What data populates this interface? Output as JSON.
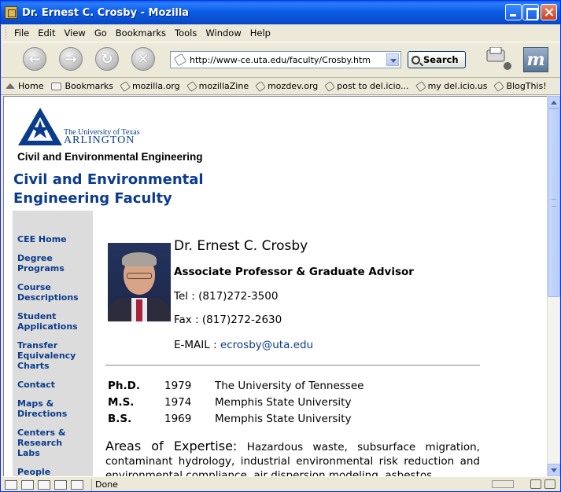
{
  "window": {
    "title": "Dr. Ernest C. Crosby - Mozilla"
  },
  "menu": [
    "File",
    "Edit",
    "View",
    "Go",
    "Bookmarks",
    "Tools",
    "Window",
    "Help"
  ],
  "nav": {
    "url": "http://www-ce.uta.edu/faculty/Crosby.htm",
    "search_label": "Search"
  },
  "bookmarks": [
    "Home",
    "Bookmarks",
    "mozilla.org",
    "mozillaZine",
    "mozdev.org",
    "post to del.icio...",
    "my del.icio.us",
    "BlogThis!"
  ],
  "header": {
    "university_line1": "The University of Texas",
    "university_line2": "ARLINGTON",
    "department": "Civil and Environmental Engineering",
    "faculty_title": "Civil and Environmental Engineering Faculty"
  },
  "sidebar": {
    "items": [
      "CEE Home",
      "Degree Programs",
      "Course Descriptions",
      "Student Applications",
      "Transfer Equivalency Charts",
      "Contact",
      "Maps & Directions",
      "Centers & Research Labs",
      "People"
    ]
  },
  "profile": {
    "name": "Dr. Ernest C. Crosby",
    "title": "Associate Professor & Graduate Advisor",
    "tel": "Tel : (817)272-3500",
    "fax": "Fax : (817)272-2630",
    "email_label": "E-MAIL : ",
    "email": "ecrosby@uta.edu",
    "degrees": [
      {
        "degree": "Ph.D.",
        "year": "1979",
        "school": "The University of Tennessee"
      },
      {
        "degree": "M.S.",
        "year": "1974",
        "school": "Memphis State University"
      },
      {
        "degree": "B.S.",
        "year": "1969",
        "school": "Memphis State University"
      }
    ],
    "expertise_heading": "Areas of Expertise:",
    "expertise_text": "Hazardous waste, subsurface migration, contaminant hydrology, industrial environmental risk reduction and environmental compliance, air dispersion modeling, asbestos"
  },
  "status": {
    "text": "Done"
  },
  "colors": {
    "link": "#0b3c8c",
    "titlebar": "#0a50d0",
    "sidebar_bg": "#dcdcdc"
  }
}
